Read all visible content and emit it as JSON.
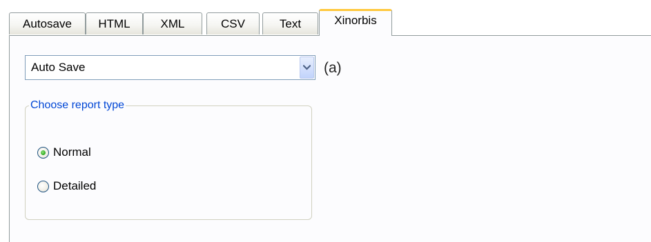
{
  "tabs": [
    {
      "label": "Autosave",
      "active": false
    },
    {
      "label": "HTML",
      "active": false
    },
    {
      "label": "XML",
      "active": false
    },
    {
      "label": "CSV",
      "active": false
    },
    {
      "label": "Text",
      "active": false
    },
    {
      "label": "Xinorbis",
      "active": true
    }
  ],
  "combo": {
    "selected": "Auto Save",
    "label": "(a)",
    "button_icon": "chevron-down-icon"
  },
  "report_type": {
    "title": "Choose report type",
    "options": [
      {
        "label": "Normal",
        "checked": true
      },
      {
        "label": "Detailed",
        "checked": false
      }
    ]
  },
  "colors": {
    "active_tab_accent": "#ffc83c",
    "group_title": "#0046d5",
    "radio_checked": "#2aa51a",
    "border": "#919b9c"
  }
}
